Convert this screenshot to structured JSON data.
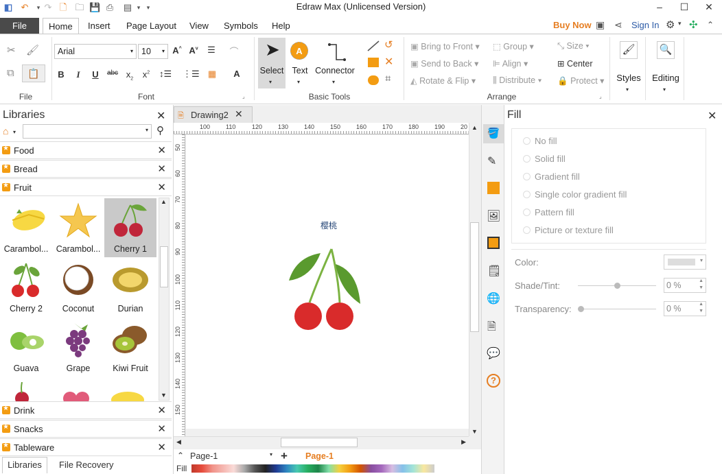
{
  "window": {
    "title": "Edraw Max (Unlicensed Version)"
  },
  "menu": {
    "file": "File",
    "tabs": [
      "Home",
      "Insert",
      "Page Layout",
      "View",
      "Symbols",
      "Help"
    ]
  },
  "topright": {
    "buy_now": "Buy Now",
    "sign_in": "Sign In"
  },
  "ribbon": {
    "font": {
      "family": "Arial",
      "size": "10",
      "group_label": "File",
      "font_group_label": "Font"
    },
    "basic_tools": {
      "select": "Select",
      "text": "Text",
      "connector": "Connector",
      "group_label": "Basic Tools"
    },
    "arrange": {
      "bring_to_front": "Bring to Front",
      "send_to_back": "Send to Back",
      "rotate_flip": "Rotate & Flip",
      "group": "Group",
      "align": "Align",
      "distribute": "Distribute",
      "size": "Size",
      "center": "Center",
      "protect": "Protect",
      "group_label": "Arrange"
    },
    "styles": "Styles",
    "editing": "Editing"
  },
  "libraries": {
    "title": "Libraries",
    "search_placeholder": "",
    "categories_top": [
      "Food",
      "Bread",
      "Fruit"
    ],
    "shapes": [
      {
        "label": "Carambol...",
        "icon": "carambola-icon"
      },
      {
        "label": "Carambol...",
        "icon": "carambola-star-icon"
      },
      {
        "label": "Cherry 1",
        "icon": "cherry-icon",
        "selected": true
      },
      {
        "label": "Cherry 2",
        "icon": "cherry-icon"
      },
      {
        "label": "Coconut",
        "icon": "coconut-icon"
      },
      {
        "label": "Durian",
        "icon": "durian-icon"
      },
      {
        "label": "Guava",
        "icon": "guava-icon"
      },
      {
        "label": "Grape",
        "icon": "grape-icon"
      },
      {
        "label": "Kiwi Fruit",
        "icon": "kiwi-icon"
      }
    ],
    "categories_bottom": [
      "Drink",
      "Snacks",
      "Tableware"
    ],
    "bottom_tabs": [
      "Libraries",
      "File Recovery"
    ]
  },
  "document": {
    "tab": "Drawing2",
    "shape_caption": "樱桃",
    "hruler": [
      "100",
      "110",
      "120",
      "130",
      "140",
      "150",
      "160",
      "170",
      "180",
      "190",
      "20"
    ],
    "vruler": [
      "50",
      "60",
      "70",
      "80",
      "90",
      "100",
      "110",
      "120",
      "130",
      "140",
      "150"
    ],
    "page_select": "Page-1",
    "page_tab": "Page-1",
    "fill_label": "Fill"
  },
  "fill_panel": {
    "title": "Fill",
    "options": [
      "No fill",
      "Solid fill",
      "Gradient fill",
      "Single color gradient fill",
      "Pattern fill",
      "Picture or texture fill"
    ],
    "color_label": "Color:",
    "shade_label": "Shade/Tint:",
    "shade_value": "0 %",
    "transparency_label": "Transparency:",
    "transparency_value": "0 %"
  },
  "colors": {
    "accent": "#e67e22",
    "file_tab": "#4a4a4a",
    "cherry_red": "#d92b2b",
    "leaf_green": "#6aa43a"
  }
}
